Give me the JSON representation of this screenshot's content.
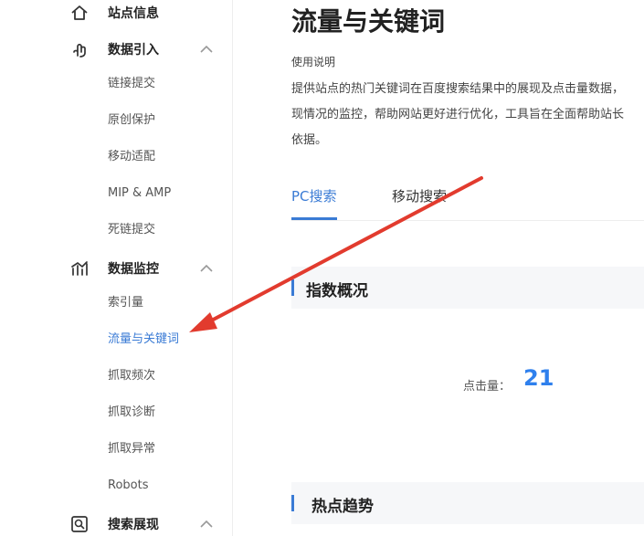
{
  "sidebar": {
    "site_info": {
      "label": "站点信息",
      "icon": "home-icon"
    },
    "data_import": {
      "label": "数据引入",
      "icon": "link-hand-icon",
      "items": [
        "链接提交",
        "原创保护",
        "移动适配",
        "MIP & AMP",
        "死链提交"
      ]
    },
    "data_monitor": {
      "label": "数据监控",
      "icon": "bar-chart-icon",
      "items": [
        "索引量",
        "流量与关键词",
        "抓取频次",
        "抓取诊断",
        "抓取异常",
        "Robots"
      ],
      "active_item": "流量与关键词"
    },
    "search_display": {
      "label": "搜索展现",
      "icon": "search-display-icon"
    }
  },
  "main": {
    "title": "流量与关键词",
    "usage": {
      "title": "使用说明",
      "lines": [
        "提供站点的热门关键词在百度搜索结果中的展现及点击量数据，",
        "现情况的监控，帮助网站更好进行优化，工具旨在全面帮助站长",
        "依据。"
      ]
    },
    "tabs": [
      {
        "label": "PC搜索",
        "active": true
      },
      {
        "label": "移动搜索",
        "active": false
      }
    ],
    "index_overview": {
      "title": "指数概况",
      "click_label": "点击量：",
      "click_value": "21"
    },
    "hot_trend": {
      "title": "热点趋势"
    }
  },
  "colors": {
    "accent": "#3a7bd5",
    "arrow": "#e23b2e",
    "metric": "#2f80ed"
  }
}
